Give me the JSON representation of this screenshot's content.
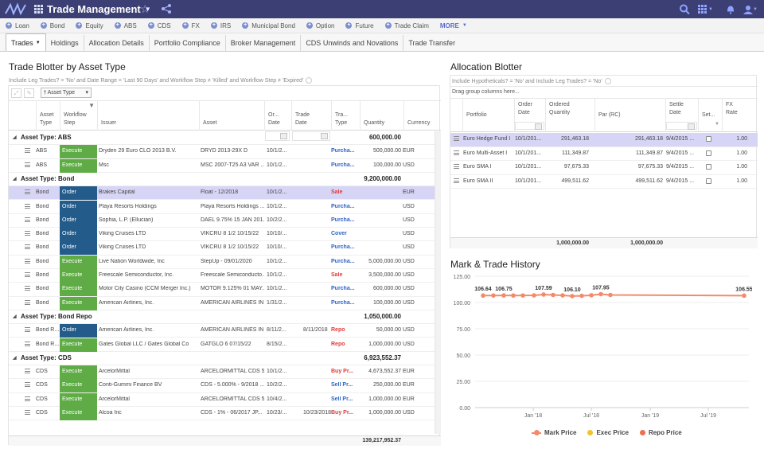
{
  "app": {
    "title": "Trade Management",
    "icons": [
      "grid-icon",
      "chevron-down-icon",
      "star-icon",
      "share-icon",
      "search-icon",
      "apps-grid-icon",
      "bell-icon",
      "user-icon"
    ]
  },
  "asset_nav": {
    "items": [
      "Loan",
      "Bond",
      "Equity",
      "ABS",
      "CDS",
      "FX",
      "IRS",
      "Municipal Bond",
      "Option",
      "Future",
      "Trade Claim"
    ],
    "more": "MORE"
  },
  "tabs": [
    "Trades",
    "Holdings",
    "Allocation Details",
    "Portfolio Compliance",
    "Broker Management",
    "CDS Unwinds and Novations",
    "Trade Transfer"
  ],
  "left": {
    "title": "Trade Blotter by Asset Type",
    "filter": "Include Leg Trades? = 'No' and Date Range = 'Last 90 Days' and Workflow Step ≠ 'Killed' and Workflow Step ≠ 'Expired'",
    "group_chip": "Asset Type",
    "columns": {
      "asset_type": "Asset Type",
      "workflow": "Workflow Step",
      "issuer": "Issuer",
      "asset": "Asset",
      "order_date": "Or... Date",
      "trade_date": "Trade Date",
      "trade_type": "Tra... Type",
      "quantity": "Quantity",
      "currency": "Currency"
    },
    "groups": [
      {
        "label": "Asset Type: ABS",
        "total": "600,000.00",
        "rows": [
          {
            "at": "ABS",
            "wf": "Execute",
            "wfk": "exec",
            "issuer": "Dryden 29 Euro CLO 2013 B.V.",
            "asset": "DRYD 2013-29X D",
            "od": "10/1/2...",
            "td": "",
            "tt": "Purcha...",
            "ttk": "buy",
            "qty": "500,000.00",
            "ccy": "EUR"
          },
          {
            "at": "ABS",
            "wf": "Execute",
            "wfk": "exec",
            "issuer": "Msc",
            "asset": "MSC 2007-T25 A3 VAR ...",
            "od": "10/1/2...",
            "td": "",
            "tt": "Purcha...",
            "ttk": "buy",
            "qty": "100,000.00",
            "ccy": "USD"
          }
        ]
      },
      {
        "label": "Asset Type: Bond",
        "total": "9,200,000.00",
        "rows": [
          {
            "at": "Bond",
            "wf": "Order",
            "wfk": "ord",
            "issuer": "Brakes Capital",
            "asset": "Float - 12/2018",
            "od": "10/1/2...",
            "td": "",
            "tt": "Sale",
            "ttk": "sell",
            "qty": "",
            "ccy": "EUR",
            "sel": true
          },
          {
            "at": "Bond",
            "wf": "Order",
            "wfk": "ord",
            "issuer": "Playa Resorts Holdings",
            "asset": "Playa Resorts Holdings ...",
            "od": "10/1/2...",
            "td": "",
            "tt": "Purcha...",
            "ttk": "buy",
            "qty": "",
            "ccy": "USD"
          },
          {
            "at": "Bond",
            "wf": "Order",
            "wfk": "ord",
            "issuer": "Sophia, L.P. (Ellucian)",
            "asset": "DAEL 9.75% 15 JAN 201...",
            "od": "10/2/2...",
            "td": "",
            "tt": "Purcha...",
            "ttk": "buy",
            "qty": "",
            "ccy": "USD"
          },
          {
            "at": "Bond",
            "wf": "Order",
            "wfk": "ord",
            "issuer": "Viking Cruises LTD",
            "asset": "VIKCRU 8 1/2 10/15/22",
            "od": "10/10/...",
            "td": "",
            "tt": "Cover",
            "ttk": "buy",
            "qty": "",
            "ccy": "USD"
          },
          {
            "at": "Bond",
            "wf": "Order",
            "wfk": "ord",
            "issuer": "Viking Cruises LTD",
            "asset": "VIKCRU 8 1/2 10/15/22",
            "od": "10/10/...",
            "td": "",
            "tt": "Purcha...",
            "ttk": "buy",
            "qty": "",
            "ccy": "USD"
          },
          {
            "at": "Bond",
            "wf": "Execute",
            "wfk": "exec",
            "issuer": "Live Nation Worldwide, Inc",
            "asset": "StepUp - 09/01/2020",
            "od": "10/1/2...",
            "td": "",
            "tt": "Purcha...",
            "ttk": "buy",
            "qty": "5,000,000.00",
            "ccy": "USD"
          },
          {
            "at": "Bond",
            "wf": "Execute",
            "wfk": "exec",
            "issuer": "Freescale Semiconductor, Inc.",
            "asset": "Freescale Semiconducto...",
            "od": "10/1/2...",
            "td": "",
            "tt": "Sale",
            "ttk": "sell",
            "qty": "3,500,000.00",
            "ccy": "USD"
          },
          {
            "at": "Bond",
            "wf": "Execute",
            "wfk": "exec",
            "issuer": "Motor City Casino (CCM Merger Inc.)",
            "asset": "MOTOR 9.125% 01 MAY...",
            "od": "10/1/2...",
            "td": "",
            "tt": "Purcha...",
            "ttk": "buy",
            "qty": "600,000.00",
            "ccy": "USD"
          },
          {
            "at": "Bond",
            "wf": "Execute",
            "wfk": "exec",
            "issuer": "American Airlines, Inc.",
            "asset": "AMERICAN AIRLINES IN...",
            "od": "1/31/2...",
            "td": "",
            "tt": "Purcha...",
            "ttk": "buy",
            "qty": "100,000.00",
            "ccy": "USD"
          }
        ]
      },
      {
        "label": "Asset Type: Bond Repo",
        "total": "1,050,000.00",
        "rows": [
          {
            "at": "Bond R...",
            "wf": "Order",
            "wfk": "ord",
            "issuer": "American Airlines, Inc.",
            "asset": "AMERICAN AIRLINES IN...",
            "od": "8/11/2...",
            "td": "8/11/2018",
            "tt": "Repo",
            "ttk": "sell",
            "qty": "50,000.00",
            "ccy": "USD"
          },
          {
            "at": "Bond R...",
            "wf": "Execute",
            "wfk": "exec",
            "issuer": "Gates Global LLC / Gates Global Co",
            "asset": "GATGLO 6 07/15/22",
            "od": "8/15/2...",
            "td": "",
            "tt": "Repo",
            "ttk": "sell",
            "qty": "1,000,000.00",
            "ccy": "USD"
          }
        ]
      },
      {
        "label": "Asset Type: CDS",
        "total": "6,923,552.37",
        "rows": [
          {
            "at": "CDS",
            "wf": "Execute",
            "wfk": "exec",
            "issuer": "ArcelorMittal",
            "asset": "ARCELORMITTAL CDS 5...",
            "od": "10/1/2...",
            "td": "",
            "tt": "Buy Pr...",
            "ttk": "sell",
            "qty": "4,673,552.37",
            "ccy": "EUR"
          },
          {
            "at": "CDS",
            "wf": "Execute",
            "wfk": "exec",
            "issuer": "Conti-Gummi Finance BV",
            "asset": "CDS - 5.000% - 9/2018 ...",
            "od": "10/2/2...",
            "td": "",
            "tt": "Sell Pr...",
            "ttk": "buy",
            "qty": "250,000.00",
            "ccy": "EUR"
          },
          {
            "at": "CDS",
            "wf": "Execute",
            "wfk": "exec",
            "issuer": "ArcelorMittal",
            "asset": "ARCELORMITTAL CDS 5...",
            "od": "10/4/2...",
            "td": "",
            "tt": "Sell Pr...",
            "ttk": "buy",
            "qty": "1,000,000.00",
            "ccy": "EUR"
          },
          {
            "at": "CDS",
            "wf": "Execute",
            "wfk": "exec",
            "issuer": "Alcoa Inc",
            "asset": "CDS - 1% - 06/2017 JP...",
            "od": "10/23/...",
            "td": "10/23/2018",
            "tt": "Buy Pr...",
            "ttk": "sell",
            "qty": "1,000,000.00",
            "ccy": "USD"
          }
        ]
      }
    ],
    "grand_total": "139,217,952.37"
  },
  "right": {
    "title": "Allocation Blotter",
    "filter": "Include Hypotheticals? = 'No' and Include Leg Trades? = 'No'",
    "drag_hint": "Drag group columns here...",
    "columns": {
      "portfolio": "Portfolio",
      "order_date": "Order Date",
      "ordered_qty": "Ordered Quantity",
      "par": "Par (RC)",
      "settle_date": "Settle Date",
      "settled": "Set...",
      "fx_rate": "FX Rate"
    },
    "rows": [
      {
        "portfolio": "Euro Hedge Fund I",
        "od": "10/1/201...",
        "oq": "291,463.18",
        "par": "291,463.18",
        "sd": "9/4/2015 ...",
        "fx": "1.00",
        "sel": true
      },
      {
        "portfolio": "Euro Multi-Asset I",
        "od": "10/1/201...",
        "oq": "111,349.87",
        "par": "111,349.87",
        "sd": "9/4/2015 ...",
        "fx": "1.00"
      },
      {
        "portfolio": "Euro SMA I",
        "od": "10/1/201...",
        "oq": "97,675.33",
        "par": "97,675.33",
        "sd": "9/4/2015 ...",
        "fx": "1.00"
      },
      {
        "portfolio": "Euro SMA II",
        "od": "10/1/201...",
        "oq": "499,511.62",
        "par": "499,511.62",
        "sd": "9/4/2015 ...",
        "fx": "1.00"
      }
    ],
    "total_oq": "1,000,000.00",
    "total_par": "1,000,000.00"
  },
  "chart_title": "Mark & Trade History",
  "chart_data": {
    "type": "line",
    "title": "Mark & Trade History",
    "ylim": [
      0,
      125
    ],
    "yticks": [
      "125.00",
      "100.00",
      "75.00",
      "50.00",
      "25.00",
      "0.00"
    ],
    "xticks": [
      "Jan '18",
      "Jul '18",
      "Jan '19",
      "Jul '19"
    ],
    "series": [
      {
        "name": "Mark Price",
        "color": "#f28b6a",
        "values": [
          106.64,
          106.7,
          106.75,
          106.7,
          106.72,
          106.8,
          107.59,
          107.2,
          106.8,
          106.1,
          106.4,
          106.9,
          107.95,
          107.2,
          106.55
        ],
        "labels": {
          "0": "106.64",
          "2": "106.75",
          "6": "107.59",
          "9": "106.10",
          "12": "107.95",
          "14": "106.55"
        }
      }
    ],
    "legend": [
      {
        "name": "Mark Price",
        "color": "#f28b6a",
        "shape": "line"
      },
      {
        "name": "Exec Price",
        "color": "#f2c12e",
        "shape": "dot"
      },
      {
        "name": "Repo Price",
        "color": "#ee6e4f",
        "shape": "dot"
      }
    ]
  }
}
